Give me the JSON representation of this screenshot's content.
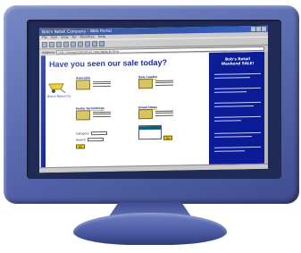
{
  "window": {
    "title": "Bob's Retail Company - Web Portal",
    "menu": [
      "File",
      "Edit",
      "View",
      "Go",
      "Favorites",
      "Help"
    ],
    "address_label": "Address",
    "address_value": "http://www.bobsretail.com/default.htm"
  },
  "page": {
    "headline": "Have you seen our sale today?",
    "logo_text": "Bob's Retail Co.",
    "logo_icon": "wheelbarrow-icon",
    "blocks": [
      {
        "title": "Adorable"
      },
      {
        "title": "Sale Leader"
      },
      {
        "title": "Home furnishings"
      },
      {
        "title": "Great Ideas"
      }
    ],
    "form": {
      "row1_label": "Category",
      "row2_label": "Search",
      "go_label": "Go"
    }
  },
  "sidebar": {
    "title": "Bob's Retail Weekend SALE!"
  },
  "colors": {
    "brand_blue": "#0c1c96",
    "accent_yellow": "#e8d000",
    "monitor": "#5b6bb0"
  }
}
